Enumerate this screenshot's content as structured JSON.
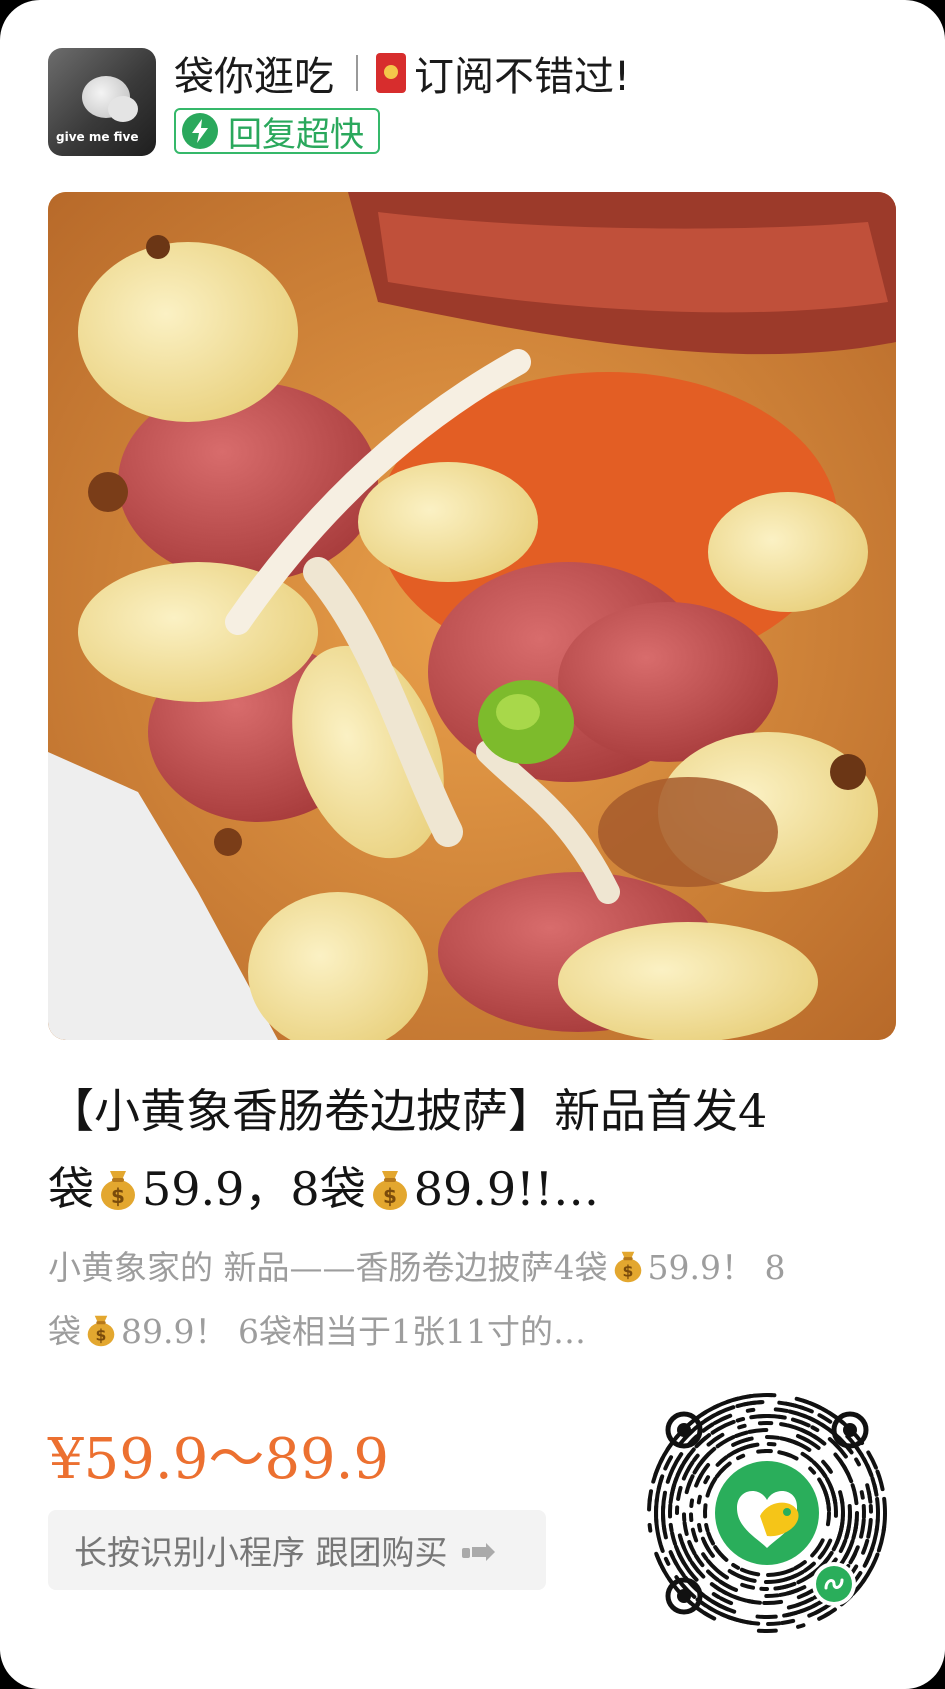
{
  "header": {
    "avatar_text": "give me five",
    "shop_name": "袋你逛吃",
    "subscribe_text": "订阅不错过!",
    "reply_badge": "回复超快"
  },
  "hero": {
    "icon": "pizza-photo"
  },
  "product": {
    "title_line1": "【小黄象香肠卷边披萨】新品首发4",
    "title_line2_a": "袋",
    "title_line2_b": "59.9，8袋",
    "title_line2_c": "89.9!!…",
    "desc_line1_a": "小黄象家的 新品——香肠卷边披萨4袋",
    "desc_line1_b": "59.9！ 8",
    "desc_line2_a": "袋",
    "desc_line2_b": "89.9！ 6袋相当于1张11寸的…",
    "price": "¥59.9～89.9",
    "cta_label": "长按识别小程序 跟团购买"
  },
  "colors": {
    "price": "#ec7030",
    "green": "#2aa85c",
    "muted": "#9d9d9d"
  }
}
